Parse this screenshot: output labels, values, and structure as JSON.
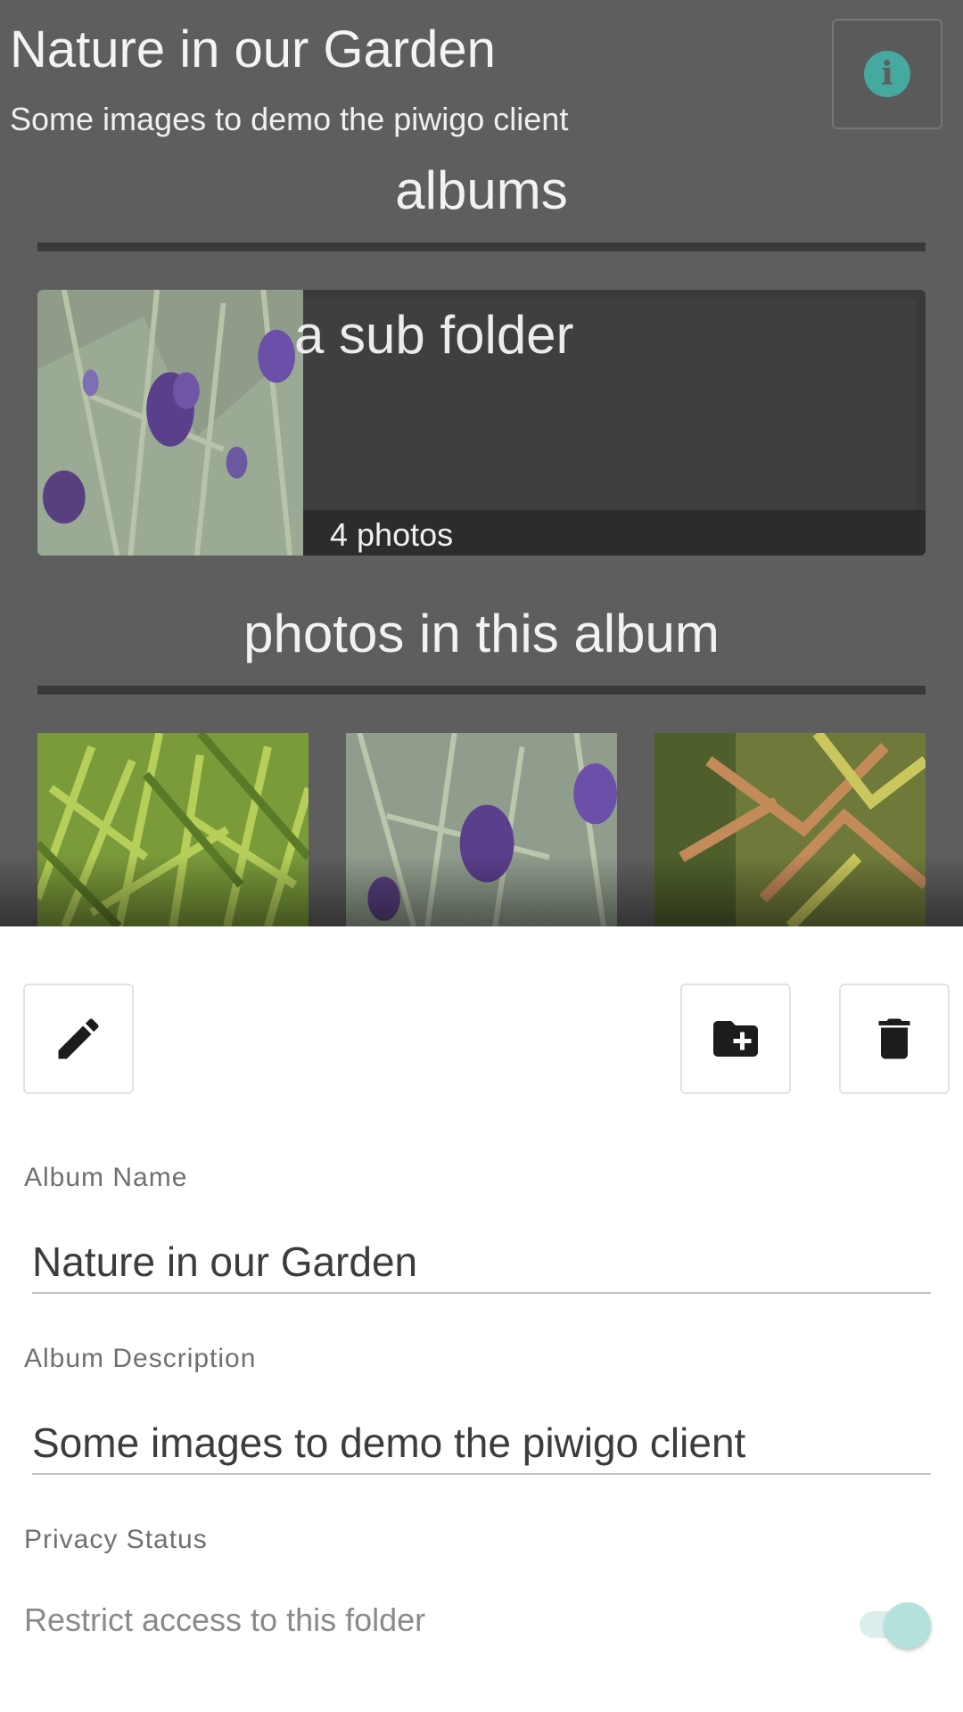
{
  "album": {
    "title": "Nature in our Garden",
    "subtitle": "Some images to demo the piwigo client",
    "info_icon": "info-icon"
  },
  "sections": {
    "albums_heading": "albums",
    "photos_heading": "photos in this album"
  },
  "subalbums": [
    {
      "name": "a sub folder",
      "count_label": "4 photos"
    }
  ],
  "photos": [
    {
      "thumbnail": "green grass"
    },
    {
      "thumbnail": "lavender flowers"
    },
    {
      "thumbnail": "japanese maple leaves"
    }
  ],
  "toolbar": {
    "edit_icon": "pencil-icon",
    "add_folder_icon": "folder-plus-icon",
    "delete_icon": "trash-icon"
  },
  "form": {
    "name_label": "Album Name",
    "name_value": "Nature in our Garden",
    "description_label": "Album Description",
    "description_value": "Some images to demo the piwigo client",
    "privacy_label": "Privacy Status",
    "restrict_label": "Restrict access to this folder",
    "restrict_enabled": true
  },
  "colors": {
    "accent": "#45a9a0",
    "overlay_bg": "#5e5e5e",
    "toggle_thumb": "#b3e2dc"
  }
}
